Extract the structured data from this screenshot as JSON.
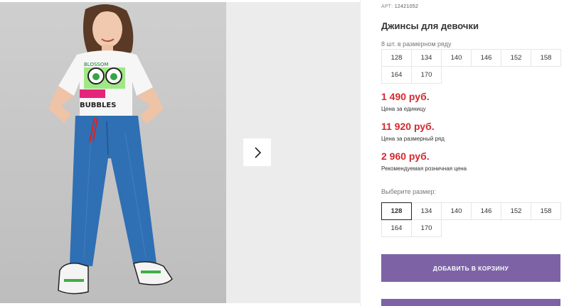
{
  "product": {
    "article_label": "АРТ:",
    "article_value": "12421052",
    "title": "Джинсы для девочки"
  },
  "size_row": {
    "caption": "8 шт. в размерном ряду",
    "sizes": [
      "128",
      "134",
      "140",
      "146",
      "152",
      "158",
      "164",
      "170"
    ]
  },
  "prices": {
    "unit_price": "1 490 руб.",
    "unit_note": "Цена за единицу",
    "row_price": "11 920 руб.",
    "row_note": "Цена за размерный ряд",
    "retail_price": "2 960 руб.",
    "retail_note": "Рекомендуемая розничная цена"
  },
  "size_select": {
    "caption": "Выберите размер:",
    "sizes": [
      "128",
      "134",
      "140",
      "146",
      "152",
      "158",
      "164",
      "170"
    ],
    "selected": "128"
  },
  "actions": {
    "add_to_cart": "ДОБАВИТЬ В КОРЗИНУ"
  },
  "gallery": {
    "shirt_print": "BUBBLES",
    "shirt_print_top": "BLOSSOM"
  },
  "colors": {
    "price": "#d32a2f",
    "button": "#7d63a6",
    "jeans": "#2f6fb3"
  },
  "icons": {
    "next": "chevron-right-icon"
  }
}
